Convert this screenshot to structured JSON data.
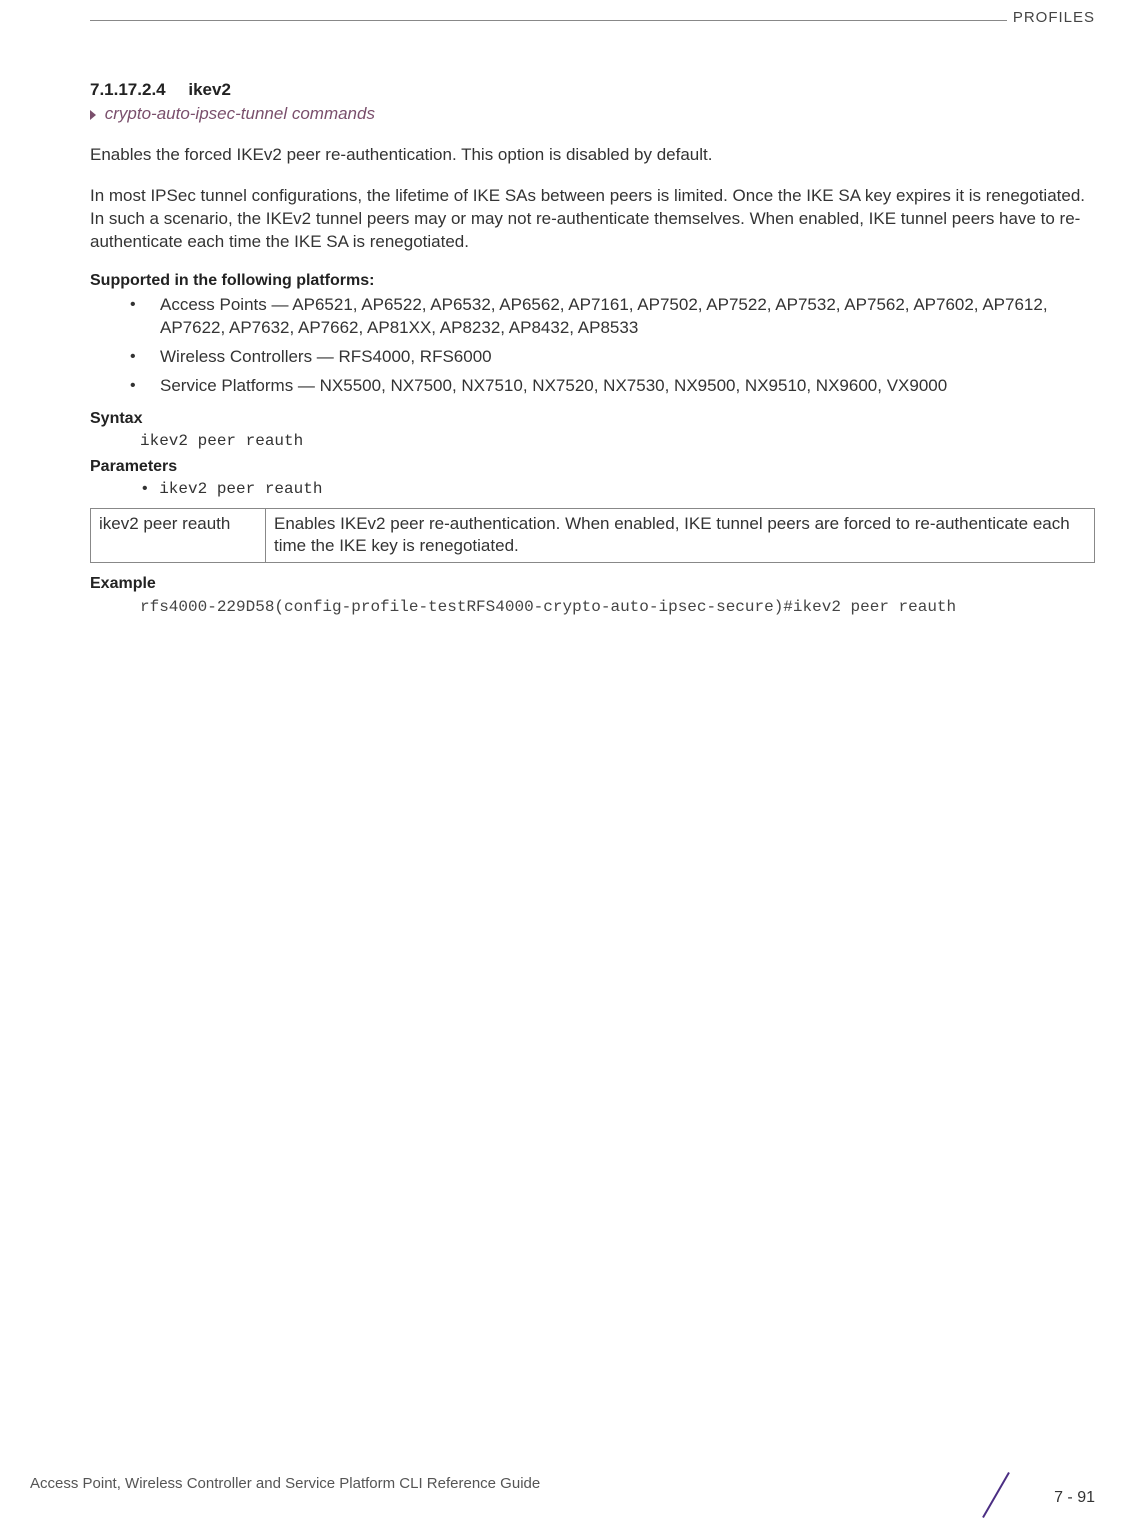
{
  "header": {
    "category": "PROFILES"
  },
  "section": {
    "number": "7.1.17.2.4",
    "title": "ikev2",
    "breadcrumb": "crypto-auto-ipsec-tunnel commands",
    "intro1": "Enables the forced IKEv2 peer re-authentication. This option is disabled by default.",
    "intro2": "In most IPSec tunnel configurations, the lifetime of IKE SAs between peers is limited. Once the IKE SA key expires it is renegotiated. In such a scenario, the IKEv2 tunnel peers may or may not re-authenticate themselves. When enabled, IKE tunnel peers have to re-authenticate each time the IKE SA is renegotiated."
  },
  "supported": {
    "heading": "Supported in the following platforms:",
    "items": [
      "Access Points — AP6521, AP6522, AP6532, AP6562, AP7161, AP7502, AP7522, AP7532, AP7562, AP7602, AP7612, AP7622, AP7632, AP7662, AP81XX, AP8232, AP8432, AP8533",
      "Wireless Controllers — RFS4000, RFS6000",
      "Service Platforms — NX5500, NX7500, NX7510, NX7520, NX7530, NX9500, NX9510, NX9600, VX9000"
    ]
  },
  "syntax": {
    "heading": "Syntax",
    "code": "ikev2 peer reauth"
  },
  "parameters": {
    "heading": "Parameters",
    "bullet": "• ikev2 peer reauth",
    "table": {
      "col1": "ikev2 peer reauth",
      "col2": "Enables IKEv2 peer re-authentication. When enabled, IKE tunnel peers are forced to re-authenticate each time the IKE key is renegotiated."
    }
  },
  "example": {
    "heading": "Example",
    "code": "rfs4000-229D58(config-profile-testRFS4000-crypto-auto-ipsec-secure)#ikev2 peer reauth"
  },
  "footer": {
    "text": "Access Point, Wireless Controller and Service Platform CLI Reference Guide",
    "page": "7 - 91"
  }
}
